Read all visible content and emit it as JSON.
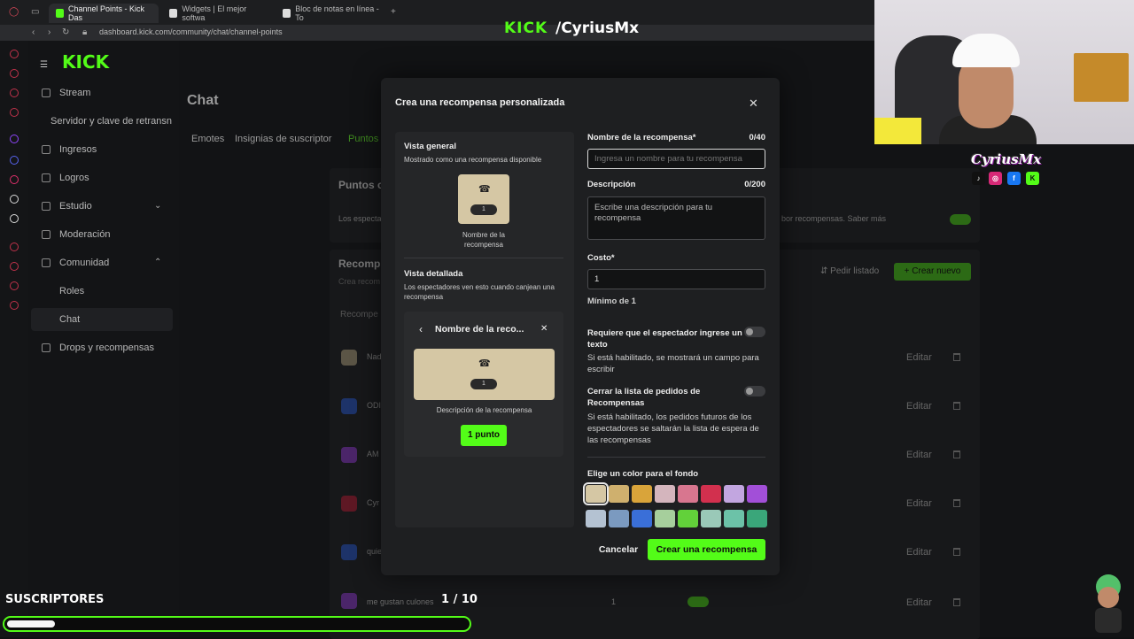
{
  "browser": {
    "tabs": [
      {
        "label": "Channel Points - Kick Das",
        "active": true,
        "color": "#53fc18"
      },
      {
        "label": "Widgets | El mejor softwa",
        "active": false,
        "color": "#dddddd"
      },
      {
        "label": "Bloc de notas en línea - To",
        "active": false,
        "color": "#dddddd"
      }
    ],
    "address": "dashboard.kick.com/community/chat/channel-points"
  },
  "overlay": {
    "brand_logo": "KICK",
    "channel": "/CyriusMx",
    "cam_brand": "CyriusMx",
    "subs_label": "SUSCRIPTORES",
    "subs_count": "1 / 10",
    "subs_progress": 0.1,
    "socials": [
      "tiktok",
      "instagram",
      "facebook",
      "kick"
    ]
  },
  "dashboard": {
    "logo": "KICK",
    "sidebar": [
      {
        "label": "Stream",
        "icon": "stream-icon"
      },
      {
        "label": "Servidor y clave de retransn",
        "icon": ""
      },
      {
        "label": "Ingresos",
        "icon": "ingresos-icon"
      },
      {
        "label": "Logros",
        "icon": "logros-icon"
      },
      {
        "label": "Estudio",
        "icon": "estudio-icon"
      },
      {
        "label": "Moderación",
        "icon": "moderacion-icon"
      },
      {
        "label": "Comunidad",
        "icon": "comunidad-icon"
      },
      {
        "label": "Roles",
        "icon": ""
      },
      {
        "label": "Chat",
        "icon": ""
      },
      {
        "label": "Drops y recompensas",
        "icon": "drops-icon"
      }
    ],
    "page_title": "Chat",
    "tabs": [
      "Emotes",
      "Insignias de suscriptor",
      "Puntos"
    ],
    "section_points": "Puntos c",
    "section_points_desc": "Los especta",
    "section_points_desc_right": "bor recompensas. Saber más",
    "section_rewards": "Recomp",
    "section_rewards_sub": "Crea recom",
    "request_list": "Pedir listado",
    "create_new": "Crear nuevo",
    "table_header": "Recompe",
    "rows": [
      {
        "name": "Nad",
        "color": "#d5c7a4",
        "edit": "Editar"
      },
      {
        "name": "ODI",
        "color": "#3a6fd8",
        "edit": "Editar"
      },
      {
        "name": "AM",
        "color": "#a24fd8",
        "edit": "Editar"
      },
      {
        "name": "Cyr",
        "color": "#c9304a",
        "edit": "Editar"
      },
      {
        "name": "quie",
        "color": "#3a6fd8",
        "edit": "Editar"
      },
      {
        "name": "me gustan culones",
        "color": "#a24fd8",
        "edit": "Editar",
        "cost": "1"
      }
    ]
  },
  "modal": {
    "title": "Crea una recompensa personalizada",
    "preview": {
      "overview_title": "Vista general",
      "overview_desc": "Mostrado como una recompensa disponible",
      "tile_cost": "1",
      "tile_name": "Nombre de la recompensa",
      "detail_title": "Vista detallada",
      "detail_desc": "Los espectadores ven esto cuando canjean una recompensa",
      "detail_header": "Nombre de la reco...",
      "detail_cost": "1",
      "detail_description": "Descripción de la recompensa",
      "detail_button": "1 punto"
    },
    "form": {
      "name_label": "Nombre de la recompensa*",
      "name_count": "0/40",
      "name_placeholder": "Ingresa un nombre para tu recompensa",
      "desc_label": "Descripción",
      "desc_count": "0/200",
      "desc_placeholder": "Escribe una descripción para tu recompensa",
      "cost_label": "Costo*",
      "cost_value": "1",
      "cost_help": "Mínimo de 1",
      "require_text_label": "Requiere que el espectador ingrese un texto",
      "require_text_help": "Si está habilitado, se mostrará un campo para escribir",
      "require_text_on": false,
      "skip_queue_label": "Cerrar la lista de pedidos de Recompensas",
      "skip_queue_help": "Si está habilitado, los pedidos futuros de los espectadores se saltarán la lista de espera de las recompensas",
      "skip_queue_on": false,
      "color_label": "Elige un color para el fondo",
      "colors": [
        "#d5c7a4",
        "#cfb06e",
        "#d9a43a",
        "#d4b5bd",
        "#d8768f",
        "#d2304e",
        "#c2a6e0",
        "#a24fd8",
        "#b4c2d2",
        "#7b9ac0",
        "#3a6fd8",
        "#a6cf9c",
        "#62d13a",
        "#9ac9b8",
        "#6cc2a8",
        "#3aa67a"
      ],
      "selected_color": 0
    },
    "cancel": "Cancelar",
    "submit": "Crear una recompensa"
  }
}
